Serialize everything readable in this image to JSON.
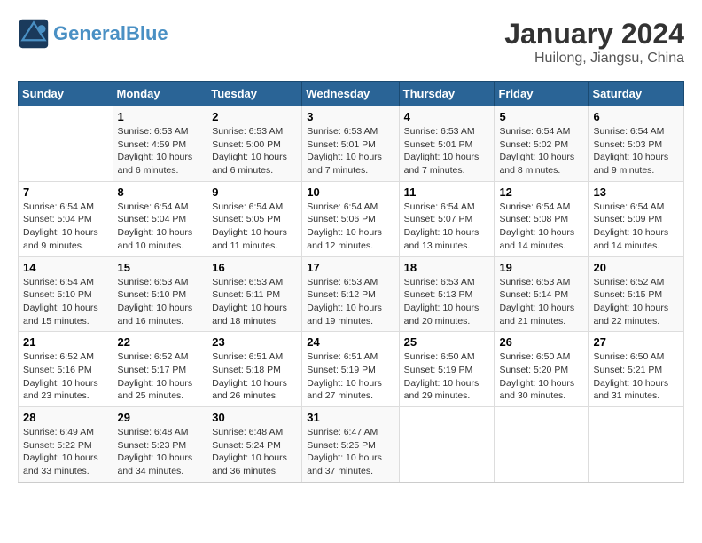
{
  "logo": {
    "line1": "General",
    "line2": "Blue"
  },
  "title": "January 2024",
  "location": "Huilong, Jiangsu, China",
  "weekdays": [
    "Sunday",
    "Monday",
    "Tuesday",
    "Wednesday",
    "Thursday",
    "Friday",
    "Saturday"
  ],
  "weeks": [
    [
      {
        "day": "",
        "info": ""
      },
      {
        "day": "1",
        "info": "Sunrise: 6:53 AM\nSunset: 4:59 PM\nDaylight: 10 hours\nand 6 minutes."
      },
      {
        "day": "2",
        "info": "Sunrise: 6:53 AM\nSunset: 5:00 PM\nDaylight: 10 hours\nand 6 minutes."
      },
      {
        "day": "3",
        "info": "Sunrise: 6:53 AM\nSunset: 5:01 PM\nDaylight: 10 hours\nand 7 minutes."
      },
      {
        "day": "4",
        "info": "Sunrise: 6:53 AM\nSunset: 5:01 PM\nDaylight: 10 hours\nand 7 minutes."
      },
      {
        "day": "5",
        "info": "Sunrise: 6:54 AM\nSunset: 5:02 PM\nDaylight: 10 hours\nand 8 minutes."
      },
      {
        "day": "6",
        "info": "Sunrise: 6:54 AM\nSunset: 5:03 PM\nDaylight: 10 hours\nand 9 minutes."
      }
    ],
    [
      {
        "day": "7",
        "info": "Sunrise: 6:54 AM\nSunset: 5:04 PM\nDaylight: 10 hours\nand 9 minutes."
      },
      {
        "day": "8",
        "info": "Sunrise: 6:54 AM\nSunset: 5:04 PM\nDaylight: 10 hours\nand 10 minutes."
      },
      {
        "day": "9",
        "info": "Sunrise: 6:54 AM\nSunset: 5:05 PM\nDaylight: 10 hours\nand 11 minutes."
      },
      {
        "day": "10",
        "info": "Sunrise: 6:54 AM\nSunset: 5:06 PM\nDaylight: 10 hours\nand 12 minutes."
      },
      {
        "day": "11",
        "info": "Sunrise: 6:54 AM\nSunset: 5:07 PM\nDaylight: 10 hours\nand 13 minutes."
      },
      {
        "day": "12",
        "info": "Sunrise: 6:54 AM\nSunset: 5:08 PM\nDaylight: 10 hours\nand 14 minutes."
      },
      {
        "day": "13",
        "info": "Sunrise: 6:54 AM\nSunset: 5:09 PM\nDaylight: 10 hours\nand 14 minutes."
      }
    ],
    [
      {
        "day": "14",
        "info": "Sunrise: 6:54 AM\nSunset: 5:10 PM\nDaylight: 10 hours\nand 15 minutes."
      },
      {
        "day": "15",
        "info": "Sunrise: 6:53 AM\nSunset: 5:10 PM\nDaylight: 10 hours\nand 16 minutes."
      },
      {
        "day": "16",
        "info": "Sunrise: 6:53 AM\nSunset: 5:11 PM\nDaylight: 10 hours\nand 18 minutes."
      },
      {
        "day": "17",
        "info": "Sunrise: 6:53 AM\nSunset: 5:12 PM\nDaylight: 10 hours\nand 19 minutes."
      },
      {
        "day": "18",
        "info": "Sunrise: 6:53 AM\nSunset: 5:13 PM\nDaylight: 10 hours\nand 20 minutes."
      },
      {
        "day": "19",
        "info": "Sunrise: 6:53 AM\nSunset: 5:14 PM\nDaylight: 10 hours\nand 21 minutes."
      },
      {
        "day": "20",
        "info": "Sunrise: 6:52 AM\nSunset: 5:15 PM\nDaylight: 10 hours\nand 22 minutes."
      }
    ],
    [
      {
        "day": "21",
        "info": "Sunrise: 6:52 AM\nSunset: 5:16 PM\nDaylight: 10 hours\nand 23 minutes."
      },
      {
        "day": "22",
        "info": "Sunrise: 6:52 AM\nSunset: 5:17 PM\nDaylight: 10 hours\nand 25 minutes."
      },
      {
        "day": "23",
        "info": "Sunrise: 6:51 AM\nSunset: 5:18 PM\nDaylight: 10 hours\nand 26 minutes."
      },
      {
        "day": "24",
        "info": "Sunrise: 6:51 AM\nSunset: 5:19 PM\nDaylight: 10 hours\nand 27 minutes."
      },
      {
        "day": "25",
        "info": "Sunrise: 6:50 AM\nSunset: 5:19 PM\nDaylight: 10 hours\nand 29 minutes."
      },
      {
        "day": "26",
        "info": "Sunrise: 6:50 AM\nSunset: 5:20 PM\nDaylight: 10 hours\nand 30 minutes."
      },
      {
        "day": "27",
        "info": "Sunrise: 6:50 AM\nSunset: 5:21 PM\nDaylight: 10 hours\nand 31 minutes."
      }
    ],
    [
      {
        "day": "28",
        "info": "Sunrise: 6:49 AM\nSunset: 5:22 PM\nDaylight: 10 hours\nand 33 minutes."
      },
      {
        "day": "29",
        "info": "Sunrise: 6:48 AM\nSunset: 5:23 PM\nDaylight: 10 hours\nand 34 minutes."
      },
      {
        "day": "30",
        "info": "Sunrise: 6:48 AM\nSunset: 5:24 PM\nDaylight: 10 hours\nand 36 minutes."
      },
      {
        "day": "31",
        "info": "Sunrise: 6:47 AM\nSunset: 5:25 PM\nDaylight: 10 hours\nand 37 minutes."
      },
      {
        "day": "",
        "info": ""
      },
      {
        "day": "",
        "info": ""
      },
      {
        "day": "",
        "info": ""
      }
    ]
  ]
}
